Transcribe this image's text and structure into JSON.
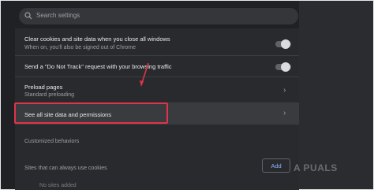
{
  "search": {
    "placeholder": "Search settings"
  },
  "rows": [
    {
      "title": "Clear cookies and site data when you close all windows",
      "subtitle": "When on, you'll also be signed out of Chrome",
      "control": "toggle-off"
    },
    {
      "title": "Send a \"Do Not Track\" request with your browsing traffic",
      "control": "toggle-off"
    },
    {
      "title": "Preload pages",
      "subtitle": "Standard preloading",
      "control": "chevron-right-icon"
    },
    {
      "title": "See all site data and permissions",
      "control": "chevron-right-icon"
    }
  ],
  "section": {
    "customized_behaviors": "Customized behaviors"
  },
  "cookies": {
    "label": "Sites that can always use cookies",
    "add_label": "Add",
    "empty_label": "No sites added"
  },
  "watermark": "A PUALS",
  "colors": {
    "highlight_border": "#e0344a",
    "accent": "#8ab4f8",
    "background": "#202124"
  }
}
